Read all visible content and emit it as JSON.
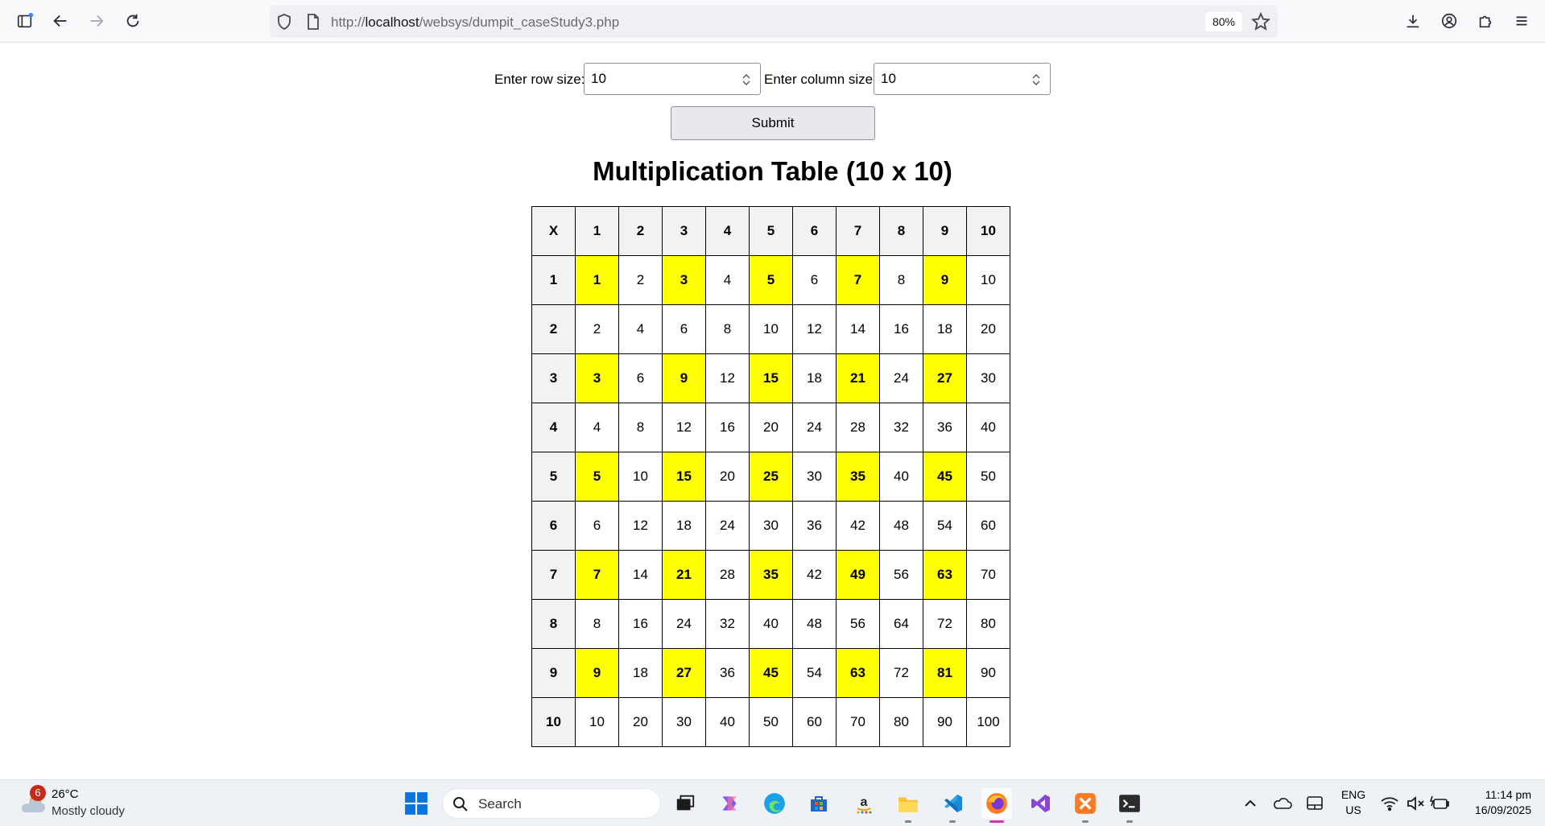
{
  "browser": {
    "url_prefix": "http://",
    "url_host": "localhost",
    "url_path": "/websys/dumpit_caseStudy3.php",
    "zoom": "80%"
  },
  "form": {
    "row_label": "Enter row size:",
    "row_value": "10",
    "col_label": "Enter column size:",
    "col_value": "10",
    "submit_label": "Submit"
  },
  "page": {
    "title": "Multiplication Table (10 x 10)"
  },
  "table": {
    "corner": "X",
    "headers": [
      "1",
      "2",
      "3",
      "4",
      "5",
      "6",
      "7",
      "8",
      "9",
      "10"
    ],
    "rows": [
      {
        "label": "1",
        "cells": [
          "1",
          "2",
          "3",
          "4",
          "5",
          "6",
          "7",
          "8",
          "9",
          "10"
        ]
      },
      {
        "label": "2",
        "cells": [
          "2",
          "4",
          "6",
          "8",
          "10",
          "12",
          "14",
          "16",
          "18",
          "20"
        ]
      },
      {
        "label": "3",
        "cells": [
          "3",
          "6",
          "9",
          "12",
          "15",
          "18",
          "21",
          "24",
          "27",
          "30"
        ]
      },
      {
        "label": "4",
        "cells": [
          "4",
          "8",
          "12",
          "16",
          "20",
          "24",
          "28",
          "32",
          "36",
          "40"
        ]
      },
      {
        "label": "5",
        "cells": [
          "5",
          "10",
          "15",
          "20",
          "25",
          "30",
          "35",
          "40",
          "45",
          "50"
        ]
      },
      {
        "label": "6",
        "cells": [
          "6",
          "12",
          "18",
          "24",
          "30",
          "36",
          "42",
          "48",
          "54",
          "60"
        ]
      },
      {
        "label": "7",
        "cells": [
          "7",
          "14",
          "21",
          "28",
          "35",
          "42",
          "49",
          "56",
          "63",
          "70"
        ]
      },
      {
        "label": "8",
        "cells": [
          "8",
          "16",
          "24",
          "32",
          "40",
          "48",
          "56",
          "64",
          "72",
          "80"
        ]
      },
      {
        "label": "9",
        "cells": [
          "9",
          "18",
          "27",
          "36",
          "45",
          "54",
          "63",
          "72",
          "81",
          "90"
        ]
      },
      {
        "label": "10",
        "cells": [
          "10",
          "20",
          "30",
          "40",
          "50",
          "60",
          "70",
          "80",
          "90",
          "100"
        ]
      }
    ],
    "highlight_color": "#ffff00",
    "header_color": "#f2f2f2"
  },
  "taskbar": {
    "weather_badge": "6",
    "weather_temp": "26°C",
    "weather_desc": "Mostly cloudy",
    "search_placeholder": "Search",
    "lang_line1": "ENG",
    "lang_line2": "US",
    "time": "11:14 pm",
    "date": "16/09/2025"
  }
}
